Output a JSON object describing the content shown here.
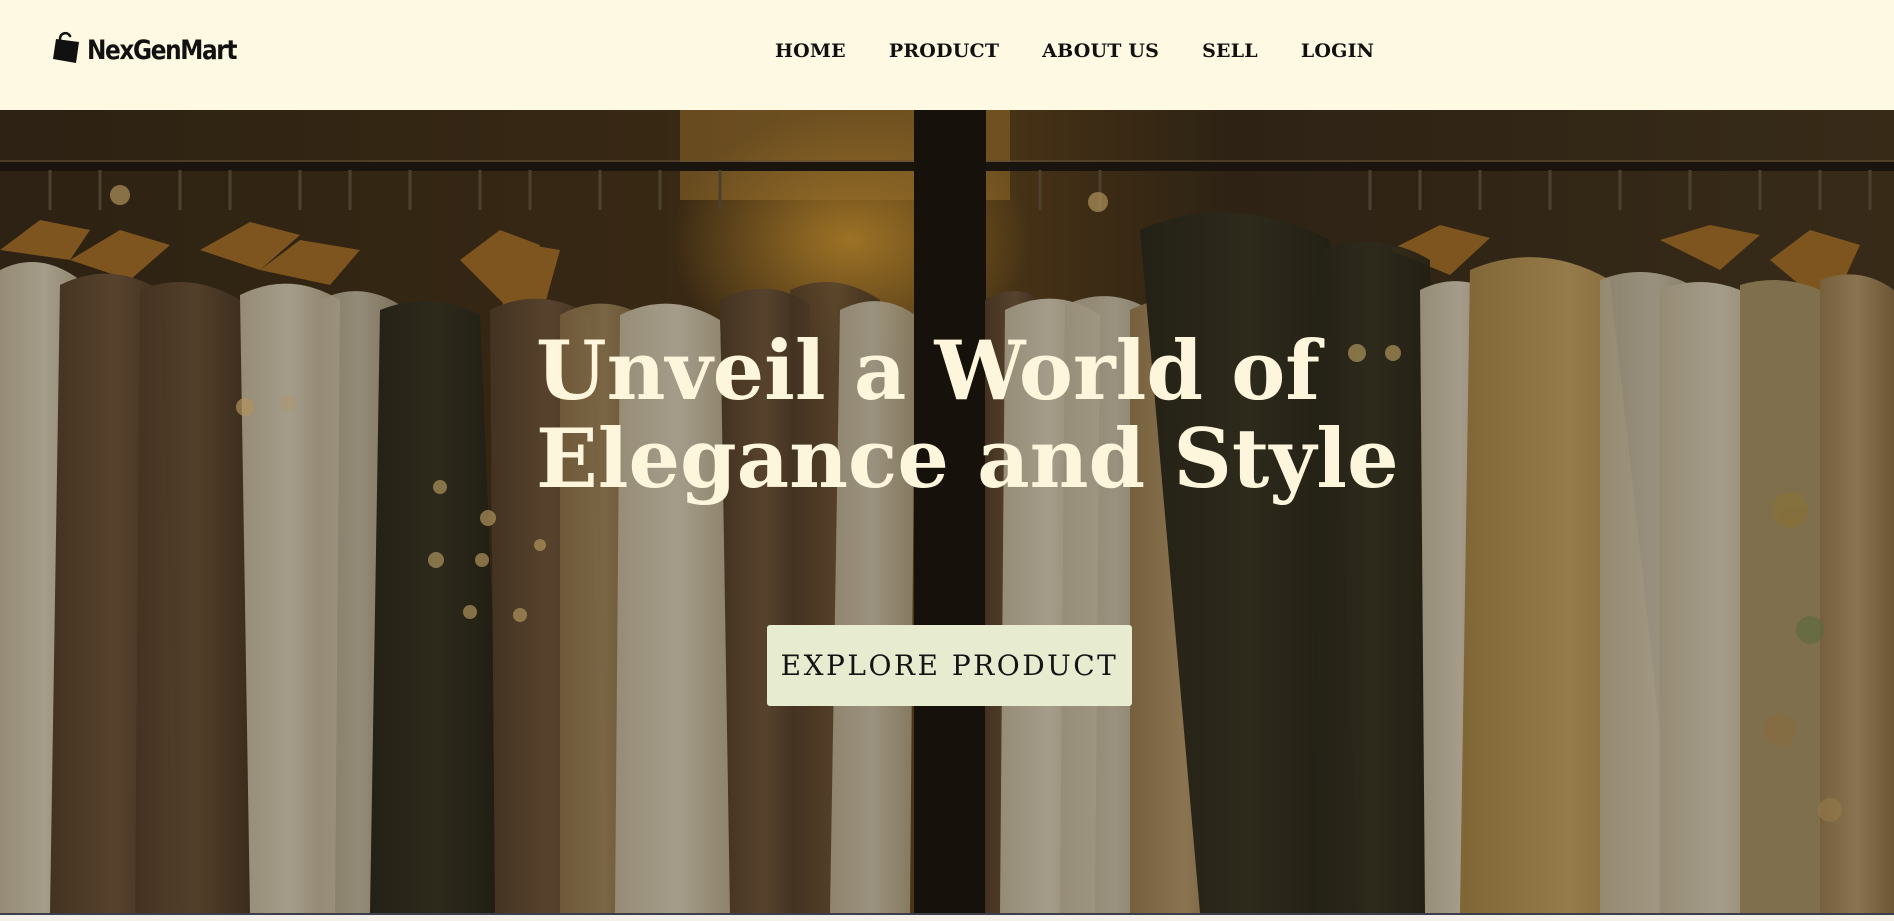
{
  "brand": {
    "name": "NexGenMart",
    "icon": "shopping-bag-icon"
  },
  "nav": {
    "items": [
      {
        "label": "HOME"
      },
      {
        "label": "PRODUCT"
      },
      {
        "label": "ABOUT US"
      },
      {
        "label": "SELL"
      },
      {
        "label": "LOGIN"
      }
    ]
  },
  "hero": {
    "title_line1": "Unveil a World of",
    "title_line2": "Elegance and Style",
    "cta_label": "EXPLORE PRODUCT",
    "background": "clothing-rack-photo"
  },
  "colors": {
    "nav_background": "#fef9e2",
    "hero_text": "#fdf6dc",
    "button_background": "#e7ecd1"
  }
}
